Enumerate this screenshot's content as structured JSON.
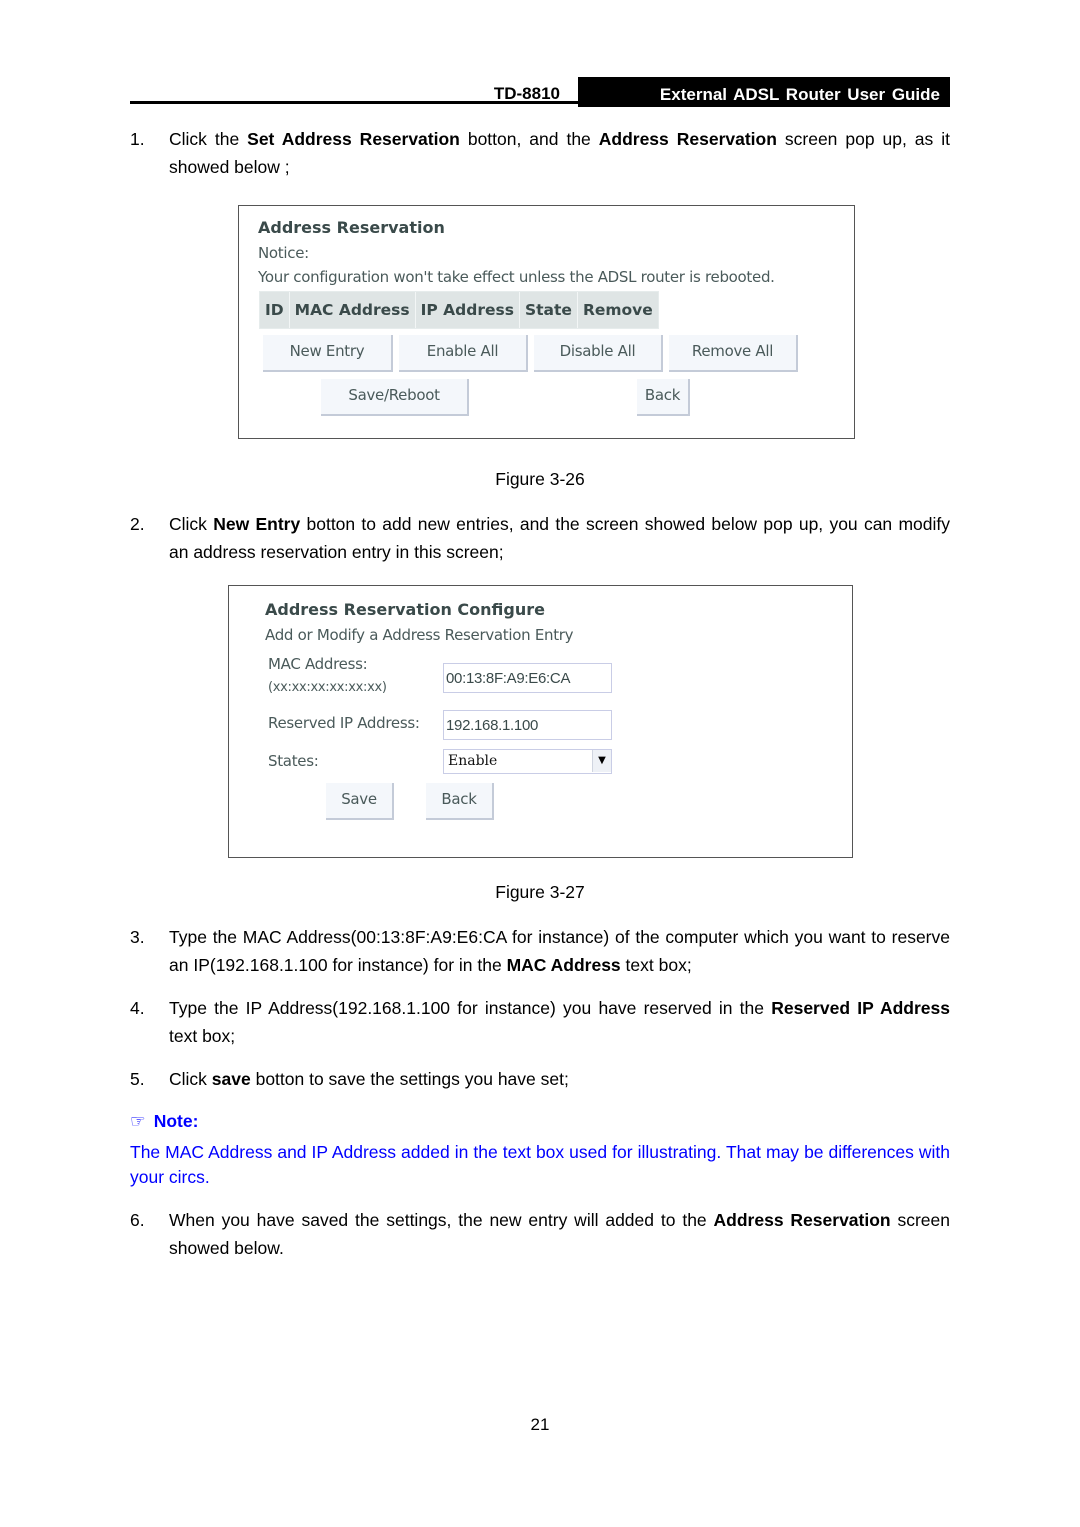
{
  "header": {
    "model": "TD-8810",
    "guide_title": "External  ADSL  Router  User  Guide"
  },
  "steps": [
    {
      "num": "1.",
      "parts": [
        "Click the ",
        "Set Address Reservation",
        " botton, and the ",
        "Address Reservation",
        " screen pop up, as it showed below ;"
      ]
    },
    {
      "num": "2.",
      "parts": [
        "Click ",
        "New Entry",
        " botton to add new entries, and the screen showed below pop up, you can modify an address reservation entry in this screen;"
      ]
    },
    {
      "num": "3.",
      "parts": [
        "Type the MAC Address(00:13:8F:A9:E6:CA for instance) of the computer which you want to reserve an IP(192.168.1.100 for instance) for in the ",
        "MAC Address",
        " text box;"
      ]
    },
    {
      "num": "4.",
      "parts": [
        "Type the IP Address(192.168.1.100 for instance) you have reserved in the ",
        "Reserved IP Address",
        " text box;"
      ]
    },
    {
      "num": "5.",
      "parts": [
        "Click ",
        "save",
        " botton to save the settings you have set;"
      ]
    },
    {
      "num": "6.",
      "parts": [
        "When you have saved the settings, the new entry will added to the ",
        "Address Reservation",
        " screen showed below."
      ]
    }
  ],
  "figures": {
    "fig26": "Figure 3-26",
    "fig27": "Figure 3-27"
  },
  "screen1": {
    "title": "Address Reservation",
    "notice_label": "Notice:",
    "notice_text": "Your configuration won't take effect unless the ADSL router is rebooted.",
    "table_headers": [
      "ID",
      "MAC Address",
      "IP Address",
      "State",
      "Remove"
    ],
    "buttons": {
      "new_entry": "New Entry",
      "enable_all": "Enable All",
      "disable_all": "Disable All",
      "remove_all": "Remove All",
      "save_reboot": "Save/Reboot",
      "back": "Back"
    }
  },
  "screen2": {
    "title": "Address Reservation Configure",
    "subtitle": "Add or Modify a Address Reservation Entry",
    "mac_label": "MAC Address:",
    "mac_format": "(xx:xx:xx:xx:xx:xx)",
    "mac_value": "00:13:8F:A9:E6:CA",
    "ip_label": "Reserved IP Address:",
    "ip_value": "192.168.1.100",
    "states_label": "States:",
    "states_value": "Enable",
    "buttons": {
      "save": "Save",
      "back": "Back"
    }
  },
  "note": {
    "icon": "pointing-hand-icon",
    "title": "Note:",
    "text": "The MAC Address and IP Address added in the text box used for illustrating. That may be differences with your circs."
  },
  "page_number": "21"
}
